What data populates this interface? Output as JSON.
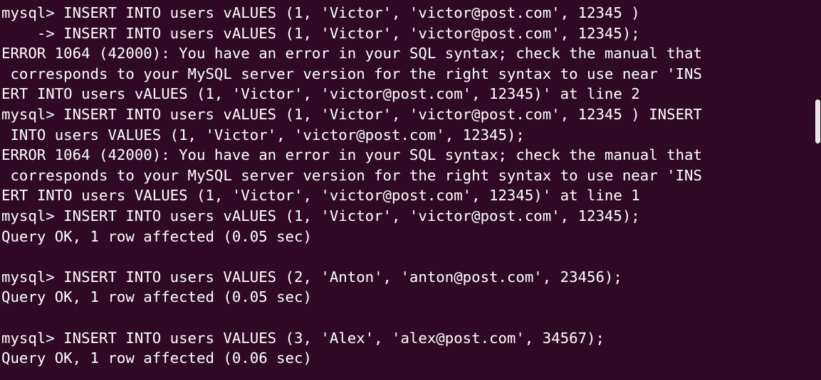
{
  "terminal": {
    "background": "#300a24",
    "foreground": "#ffffff",
    "lines": [
      "mysql> INSERT INTO users vALUES (1, 'Victor', 'victor@post.com', 12345 )",
      "    -> INSERT INTO users vALUES (1, 'Victor', 'victor@post.com', 12345);",
      "ERROR 1064 (42000): You have an error in your SQL syntax; check the manual that",
      " corresponds to your MySQL server version for the right syntax to use near 'INS",
      "ERT INTO users vALUES (1, 'Victor', 'victor@post.com', 12345)' at line 2",
      "mysql> INSERT INTO users vALUES (1, 'Victor', 'victor@post.com', 12345 ) INSERT",
      " INTO users VALUES (1, 'Victor', 'victor@post.com', 12345);",
      "ERROR 1064 (42000): You have an error in your SQL syntax; check the manual that",
      " corresponds to your MySQL server version for the right syntax to use near 'INS",
      "ERT INTO users VALUES (1, 'Victor', 'victor@post.com', 12345)' at line 1",
      "mysql> INSERT INTO users vALUES (1, 'Victor', 'victor@post.com', 12345);",
      "Query OK, 1 row affected (0.05 sec)",
      "",
      "mysql> INSERT INTO users VALUES (2, 'Anton', 'anton@post.com', 23456);",
      "Query OK, 1 row affected (0.05 sec)",
      "",
      "mysql> INSERT INTO users VALUES (3, 'Alex', 'alex@post.com', 34567);",
      "Query OK, 1 row affected (0.06 sec)"
    ]
  }
}
